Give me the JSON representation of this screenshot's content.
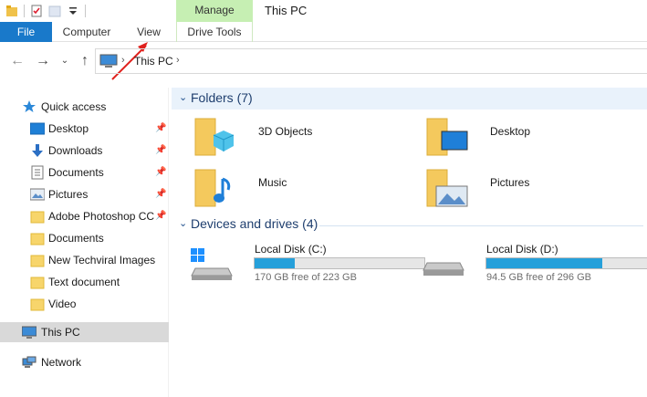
{
  "window": {
    "title": "This PC",
    "context_tab_group": "Manage"
  },
  "ribbon": {
    "tabs": [
      {
        "label": "File"
      },
      {
        "label": "Computer"
      },
      {
        "label": "View"
      },
      {
        "label": "Drive Tools"
      }
    ]
  },
  "address": {
    "path": [
      "This PC"
    ]
  },
  "sidebar": {
    "quick_access": "Quick access",
    "items": [
      {
        "label": "Desktop",
        "pinned": true
      },
      {
        "label": "Downloads",
        "pinned": true
      },
      {
        "label": "Documents",
        "pinned": true
      },
      {
        "label": "Pictures",
        "pinned": true
      },
      {
        "label": "Adobe Photoshop CC",
        "pinned": true
      },
      {
        "label": "Documents",
        "pinned": false
      },
      {
        "label": "New Techviral Images",
        "pinned": false
      },
      {
        "label": "Text document",
        "pinned": false
      },
      {
        "label": "Video",
        "pinned": false
      }
    ],
    "this_pc": "This PC",
    "network": "Network"
  },
  "folders": {
    "header": "Folders (7)",
    "items": [
      {
        "label": "3D Objects",
        "icon": "3d-objects-folder-icon"
      },
      {
        "label": "Desktop",
        "icon": "desktop-folder-icon"
      },
      {
        "label": "Music",
        "icon": "music-folder-icon"
      },
      {
        "label": "Pictures",
        "icon": "pictures-folder-icon"
      }
    ]
  },
  "drives": {
    "header": "Devices and drives (4)",
    "items": [
      {
        "name": "Local Disk (C:)",
        "free_text": "170 GB free of 223 GB",
        "used_fraction": 0.238
      },
      {
        "name": "Local Disk (D:)",
        "free_text": "94.5 GB free of 296 GB",
        "used_fraction": 0.681
      }
    ]
  },
  "colors": {
    "accent": "#1979ca",
    "manage": "#c6efb3",
    "drive_bar": "#26a0da",
    "selected": "#d9d9d9",
    "annotation": "#e0201c"
  }
}
